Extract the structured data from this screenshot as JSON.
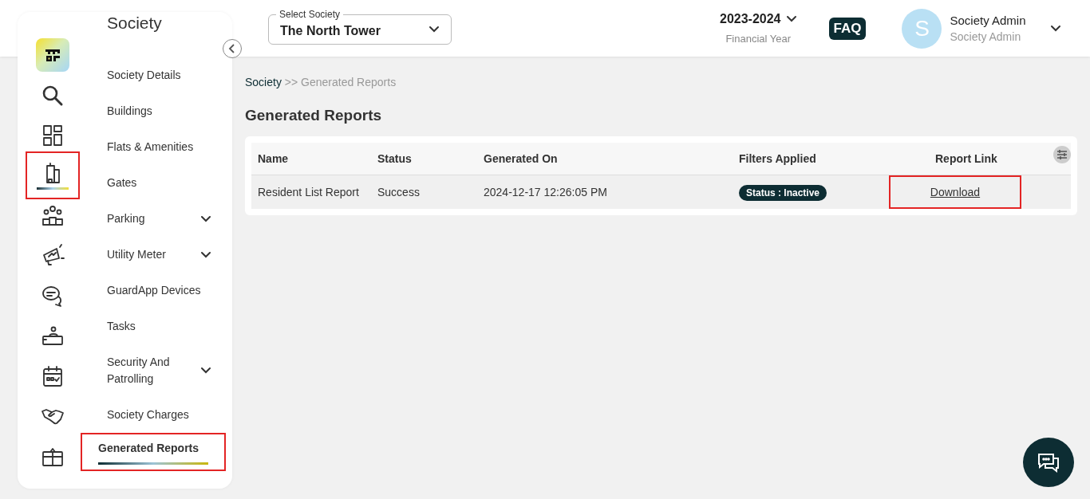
{
  "header": {
    "select": {
      "label": "Select Society",
      "value": "The North Tower"
    },
    "year": {
      "value": "2023-2024",
      "label": "Financial Year"
    },
    "faq": "FAQ",
    "user": {
      "initial": "S",
      "name": "Society Admin",
      "role": "Society Admin"
    }
  },
  "sidebar": {
    "title": "Society",
    "icons": [
      {
        "kind": "logo",
        "selected": false,
        "highlighted": false
      },
      {
        "kind": "search",
        "selected": false,
        "highlighted": false
      },
      {
        "kind": "grid",
        "selected": false,
        "highlighted": false
      },
      {
        "kind": "building",
        "selected": true,
        "highlighted": true
      },
      {
        "kind": "people",
        "selected": false,
        "highlighted": false
      },
      {
        "kind": "megaphone",
        "selected": false,
        "highlighted": false
      },
      {
        "kind": "chat",
        "selected": false,
        "highlighted": false
      },
      {
        "kind": "desk",
        "selected": false,
        "highlighted": false
      },
      {
        "kind": "calendar",
        "selected": false,
        "highlighted": false
      },
      {
        "kind": "handshake",
        "selected": false,
        "highlighted": false
      },
      {
        "kind": "box",
        "selected": false,
        "highlighted": false
      }
    ],
    "items": [
      {
        "label": "Society Details",
        "expandable": false,
        "selected": false,
        "highlighted": false
      },
      {
        "label": "Buildings",
        "expandable": false,
        "selected": false,
        "highlighted": false
      },
      {
        "label": "Flats & Amenities",
        "expandable": false,
        "selected": false,
        "highlighted": false
      },
      {
        "label": "Gates",
        "expandable": false,
        "selected": false,
        "highlighted": false
      },
      {
        "label": "Parking",
        "expandable": true,
        "selected": false,
        "highlighted": false
      },
      {
        "label": "Utility Meter",
        "expandable": true,
        "selected": false,
        "highlighted": false
      },
      {
        "label": "GuardApp Devices",
        "expandable": false,
        "selected": false,
        "highlighted": false
      },
      {
        "label": "Tasks",
        "expandable": false,
        "selected": false,
        "highlighted": false
      },
      {
        "label": "Security And Patrolling",
        "expandable": true,
        "selected": false,
        "highlighted": false
      },
      {
        "label": "Society Charges",
        "expandable": false,
        "selected": false,
        "highlighted": false
      },
      {
        "label": "Generated Reports",
        "expandable": false,
        "selected": true,
        "highlighted": true
      }
    ]
  },
  "breadcrumb": {
    "parent": "Society",
    "separator": ">>",
    "current": "Generated Reports"
  },
  "page_title": "Generated Reports",
  "table": {
    "columns": [
      "Name",
      "Status",
      "Generated On",
      "Filters Applied",
      "Report Link"
    ],
    "rows": [
      {
        "name": "Resident List Report",
        "status": "Success",
        "generated_on": "2024-12-17 12:26:05 PM",
        "filters": [
          "Status : Inactive"
        ],
        "link": {
          "label": "Download",
          "highlighted": true
        }
      }
    ]
  }
}
